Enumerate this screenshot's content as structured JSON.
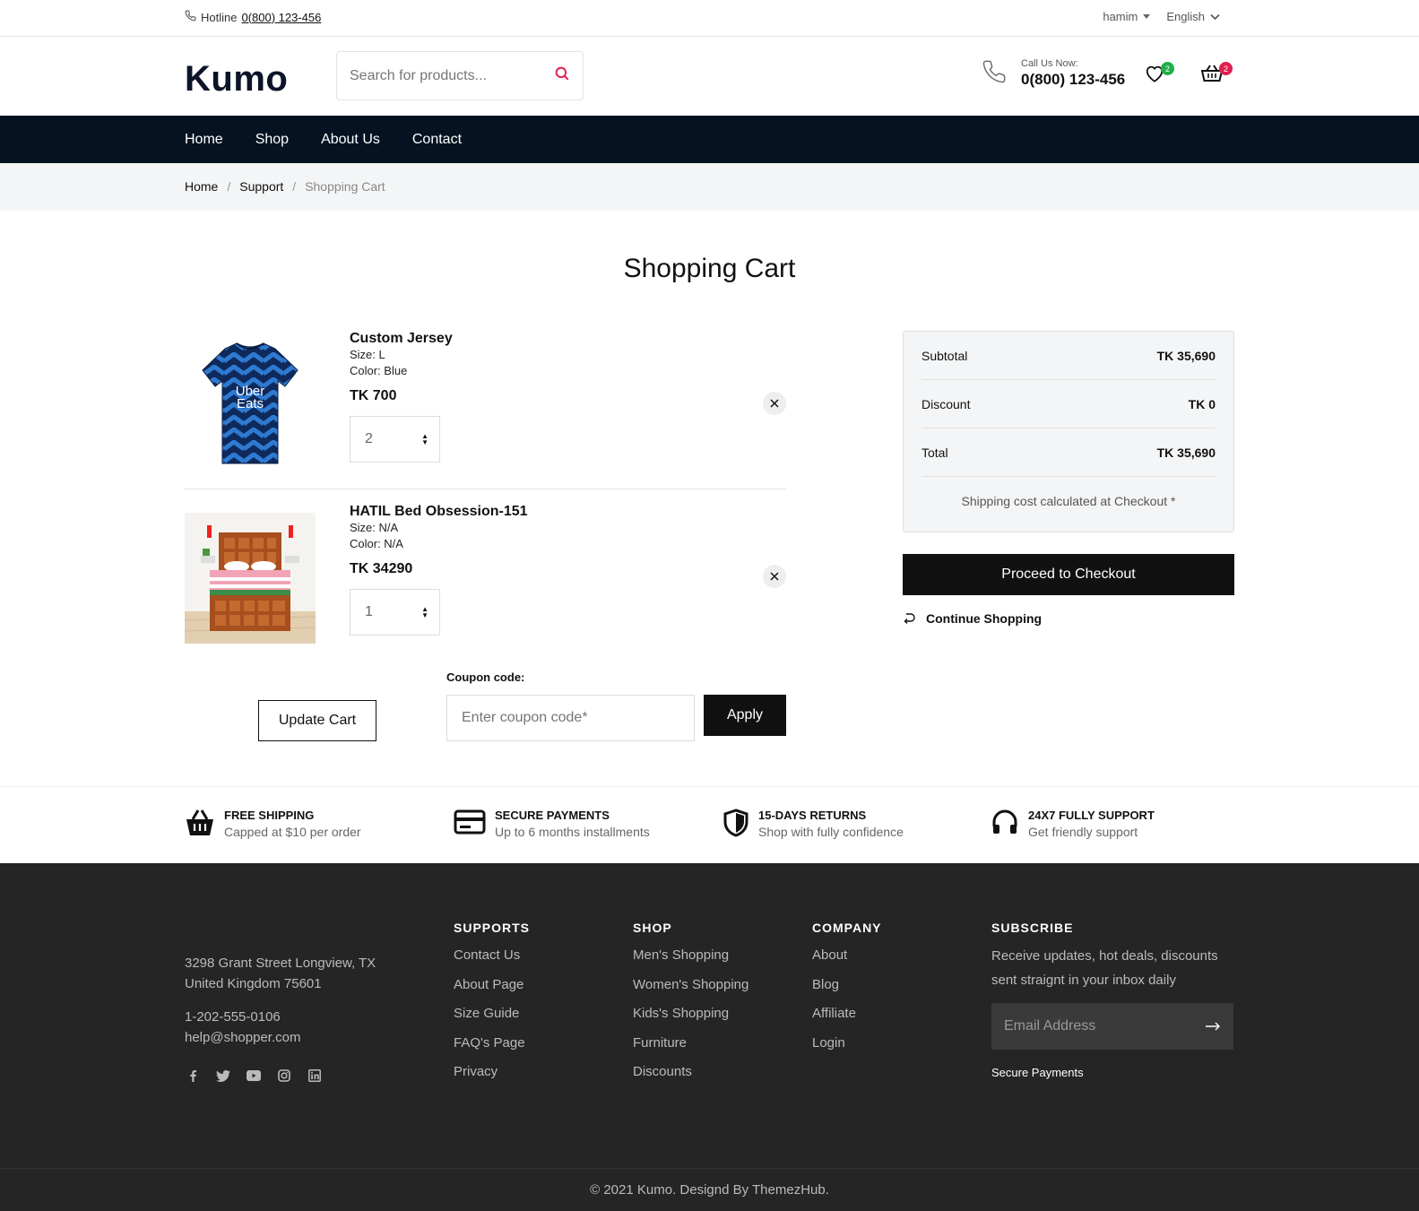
{
  "topbar": {
    "hotline_label": "Hotline",
    "hotline_number": "0(800) 123-456",
    "user": "hamim",
    "language": "English"
  },
  "header": {
    "logo": "Kumo",
    "search_placeholder": "Search for products...",
    "call_label": "Call Us Now:",
    "call_number": "0(800) 123-456",
    "wishlist_count": "2",
    "cart_count": "2"
  },
  "nav": [
    "Home",
    "Shop",
    "About Us",
    "Contact"
  ],
  "breadcrumb": {
    "home": "Home",
    "support": "Support",
    "current": "Shopping Cart",
    "separator": "/"
  },
  "page_title": "Shopping Cart",
  "cart": {
    "items": [
      {
        "name": "Custom Jersey",
        "size": "Size: L",
        "color": "Color: Blue",
        "price": "TK 700",
        "qty": "2"
      },
      {
        "name": "HATIL Bed Obsession-151",
        "size": "Size: N/A",
        "color": "Color: N/A",
        "price": "TK 34290",
        "qty": "1"
      }
    ],
    "update_label": "Update Cart",
    "coupon_label": "Coupon code:",
    "coupon_placeholder": "Enter coupon code*",
    "apply_label": "Apply"
  },
  "summary": {
    "subtotal_label": "Subtotal",
    "subtotal": "TK 35,690",
    "discount_label": "Discount",
    "discount": "TK 0",
    "total_label": "Total",
    "total": "TK 35,690",
    "shipping_note": "Shipping cost calculated at Checkout *",
    "checkout_label": "Proceed to Checkout",
    "continue_label": "Continue Shopping"
  },
  "features": [
    {
      "title": "FREE SHIPPING",
      "sub": "Capped at $10 per order"
    },
    {
      "title": "SECURE PAYMENTS",
      "sub": "Up to 6 months installments"
    },
    {
      "title": "15-DAYS RETURNS",
      "sub": "Shop with fully confidence"
    },
    {
      "title": "24X7 FULLY SUPPORT",
      "sub": "Get friendly support"
    }
  ],
  "footer": {
    "address_line1": "3298 Grant Street Longview, TX",
    "address_line2": "United Kingdom 75601",
    "phone": "1-202-555-0106",
    "email": "help@shopper.com",
    "columns": [
      {
        "title": "SUPPORTS",
        "links": [
          "Contact Us",
          "About Page",
          "Size Guide",
          "FAQ's Page",
          "Privacy"
        ]
      },
      {
        "title": "SHOP",
        "links": [
          "Men's Shopping",
          "Women's Shopping",
          "Kids's Shopping",
          "Furniture",
          "Discounts"
        ]
      },
      {
        "title": "COMPANY",
        "links": [
          "About",
          "Blog",
          "Affiliate",
          "Login"
        ]
      }
    ],
    "subscribe_title": "SUBSCRIBE",
    "subscribe_text": "Receive updates, hot deals, discounts sent straignt in your inbox daily",
    "email_placeholder": "Email Address",
    "secure_payments": "Secure Payments",
    "copyright": "© 2021 Kumo. Designd By ThemezHub."
  },
  "colors": {
    "nav_bg": "#051221",
    "accent": "#e01f4f",
    "wishlist_badge": "#1fae4a",
    "footer_bg": "#252525"
  }
}
